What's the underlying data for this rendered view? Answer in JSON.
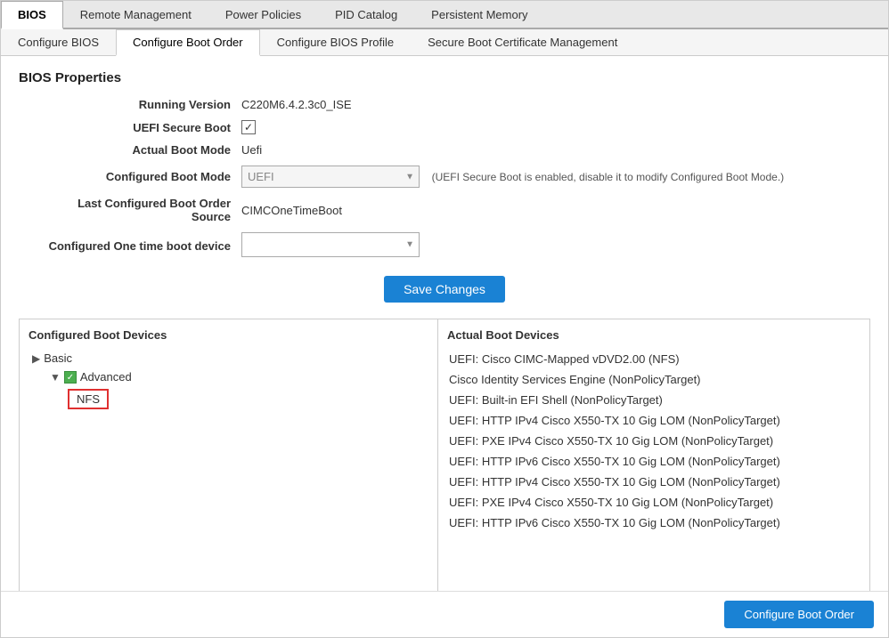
{
  "top_tabs": {
    "items": [
      {
        "label": "BIOS",
        "active": true
      },
      {
        "label": "Remote Management",
        "active": false
      },
      {
        "label": "Power Policies",
        "active": false
      },
      {
        "label": "PID Catalog",
        "active": false
      },
      {
        "label": "Persistent Memory",
        "active": false
      }
    ]
  },
  "sub_tabs": {
    "items": [
      {
        "label": "Configure BIOS",
        "active": false
      },
      {
        "label": "Configure Boot Order",
        "active": true
      },
      {
        "label": "Configure BIOS Profile",
        "active": false
      },
      {
        "label": "Secure Boot Certificate Management",
        "active": false
      }
    ]
  },
  "section_title": "BIOS Properties",
  "properties": {
    "running_version_label": "Running Version",
    "running_version_value": "C220M6.4.2.3c0_ISE",
    "uefi_secure_boot_label": "UEFI Secure Boot",
    "actual_boot_mode_label": "Actual Boot Mode",
    "actual_boot_mode_value": "Uefi",
    "configured_boot_mode_label": "Configured Boot Mode",
    "configured_boot_mode_value": "UEFI",
    "configured_boot_mode_note": "(UEFI Secure Boot is enabled, disable it to modify Configured Boot Mode.)",
    "last_configured_label": "Last Configured Boot Order Source",
    "last_configured_value": "CIMCOneTimeBoot",
    "one_time_boot_label": "Configured One time boot device",
    "one_time_boot_value": ""
  },
  "save_button_label": "Save Changes",
  "left_panel": {
    "title": "Configured Boot Devices",
    "items": [
      {
        "type": "group",
        "label": "Basic",
        "level": 1,
        "expanded": false
      },
      {
        "type": "group",
        "label": "Advanced",
        "level": 1,
        "expanded": true,
        "checked": true
      },
      {
        "type": "leaf",
        "label": "NFS",
        "level": 2,
        "highlighted": true
      }
    ]
  },
  "right_panel": {
    "title": "Actual Boot Devices",
    "items": [
      "UEFI: Cisco CIMC-Mapped vDVD2.00 (NFS)",
      "Cisco Identity Services Engine (NonPolicyTarget)",
      "UEFI: Built-in EFI Shell (NonPolicyTarget)",
      "UEFI: HTTP IPv4 Cisco X550-TX 10 Gig LOM (NonPolicyTarget)",
      "UEFI: PXE IPv4 Cisco X550-TX 10 Gig LOM (NonPolicyTarget)",
      "UEFI: HTTP IPv6 Cisco X550-TX 10 Gig LOM (NonPolicyTarget)",
      "UEFI: HTTP IPv4 Cisco X550-TX 10 Gig LOM (NonPolicyTarget)",
      "UEFI: PXE IPv4 Cisco X550-TX 10 Gig LOM (NonPolicyTarget)",
      "UEFI: HTTP IPv6 Cisco X550-TX 10 Gig LOM (NonPolicyTarget)"
    ]
  },
  "configure_boot_btn_label": "Configure Boot Order"
}
